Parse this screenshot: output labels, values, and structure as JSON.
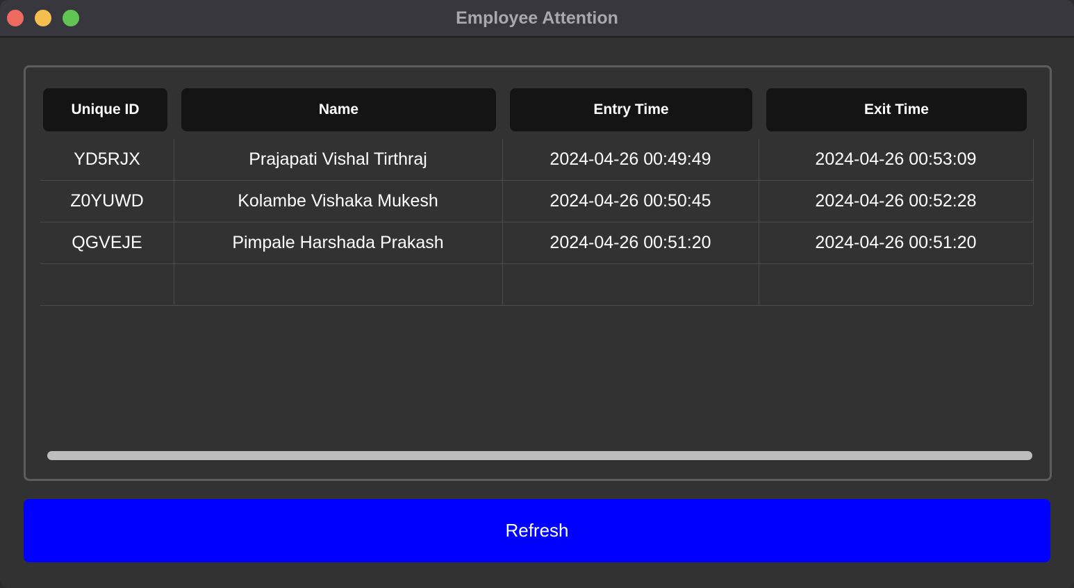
{
  "window": {
    "title": "Employee Attention"
  },
  "table": {
    "columns": [
      "Unique ID",
      "Name",
      "Entry Time",
      "Exit Time"
    ],
    "rows": [
      [
        "YD5RJX",
        "Prajapati Vishal Tirthraj",
        "2024-04-26 00:49:49",
        "2024-04-26 00:53:09"
      ],
      [
        "Z0YUWD",
        "Kolambe Vishaka Mukesh",
        "2024-04-26 00:50:45",
        "2024-04-26 00:52:28"
      ],
      [
        "QGVEJE",
        "Pimpale Harshada Prakash",
        "2024-04-26 00:51:20",
        "2024-04-26 00:51:20"
      ],
      [
        "",
        "",
        "",
        ""
      ]
    ]
  },
  "actions": {
    "refresh_label": "Refresh"
  },
  "colors": {
    "window_background": "#323232",
    "header_background": "#141414",
    "refresh_button": "#0000ff",
    "close_button": "#ed6a5e",
    "minimize_button": "#f5bf4f",
    "maximize_button": "#61c554"
  }
}
